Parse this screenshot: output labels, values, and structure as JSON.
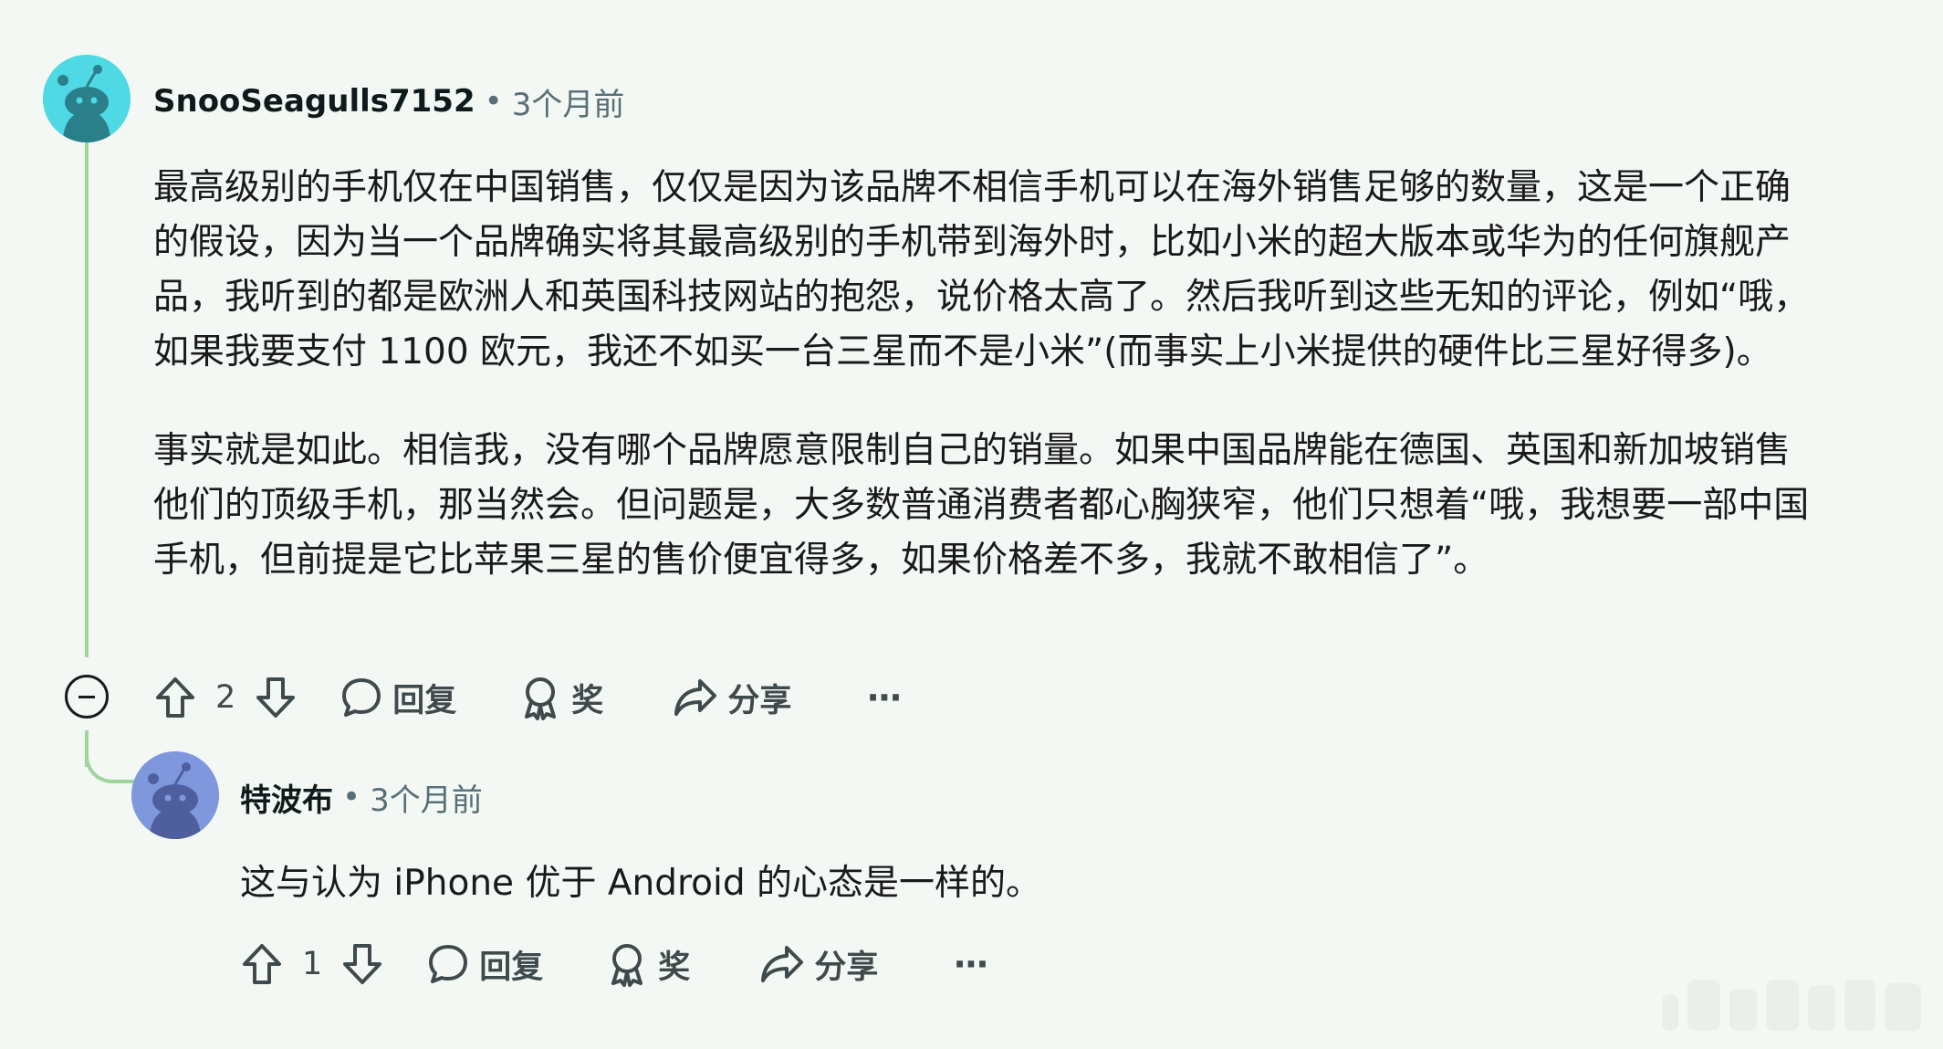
{
  "comments": [
    {
      "username": "SnooSeagulls7152",
      "time": "3个月前",
      "paragraphs": [
        "最高级别的手机仅在中国销售，仅仅是因为该品牌不相信手机可以在海外销售足够的数量，这是一个正确的假设，因为当一个品牌确实将其最高级别的手机带到海外时，比如小米的超大版本或华为的任何旗舰产品，我听到的都是欧洲人和英国科技网站的抱怨，说价格太高了。然后我听到这些无知的评论，例如“哦，如果我要支付 1100 欧元，我还不如买一台三星而不是小米”(而事实上小米提供的硬件比三星好得多)。",
        "事实就是如此。相信我，没有哪个品牌愿意限制自己的销量。如果中国品牌能在德国、英国和新加坡销售他们的顶级手机，那当然会。但问题是，大多数普通消费者都心胸狭窄，他们只想着“哦，我想要一部中国手机，但前提是它比苹果三星的售价便宜得多，如果价格差不多，我就不敢相信了”。"
      ],
      "votes": "2",
      "reply_label": "回复",
      "award_label": "奖",
      "share_label": "分享",
      "more_label": "···",
      "avatar_color": "#4fd9e4"
    },
    {
      "username": "特波布",
      "time": "3个月前",
      "paragraphs": [
        "这与认为 iPhone 优于 Android 的心态是一样的。"
      ],
      "votes": "1",
      "reply_label": "回复",
      "award_label": "奖",
      "share_label": "分享",
      "more_label": "···",
      "avatar_color": "#7f98dd"
    }
  ],
  "separator": "•"
}
